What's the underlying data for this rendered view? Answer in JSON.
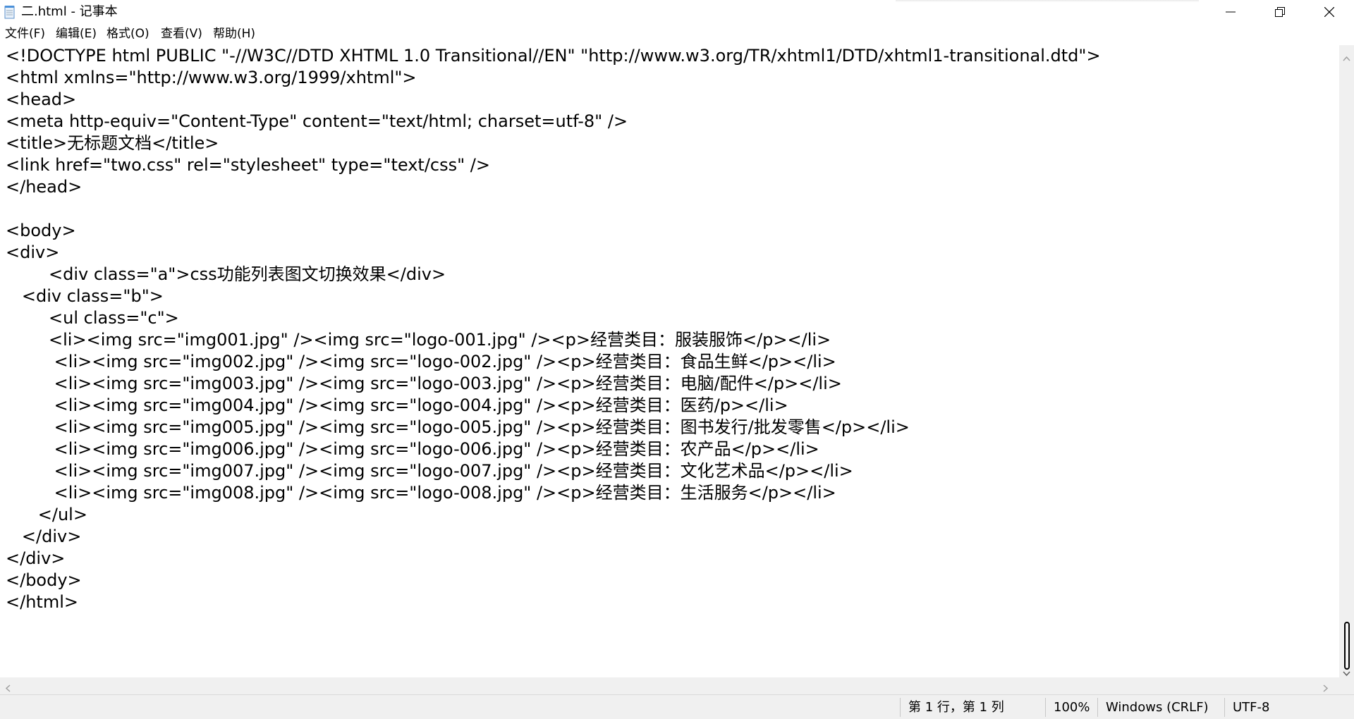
{
  "window": {
    "title": "二.html - 记事本",
    "minimize_glyph": "minimize-icon",
    "maximize_glyph": "restore-icon",
    "close_glyph": "close-icon"
  },
  "menu": {
    "items": [
      "文件(F)",
      "编辑(E)",
      "格式(O)",
      "查看(V)",
      "帮助(H)"
    ]
  },
  "editor": {
    "lines": [
      "<!DOCTYPE html PUBLIC \"-//W3C//DTD XHTML 1.0 Transitional//EN\" \"http://www.w3.org/TR/xhtml1/DTD/xhtml1-transitional.dtd\">",
      "<html xmlns=\"http://www.w3.org/1999/xhtml\">",
      "<head>",
      "<meta http-equiv=\"Content-Type\" content=\"text/html; charset=utf-8\" />",
      "<title>无标题文档</title>",
      "<link href=\"two.css\" rel=\"stylesheet\" type=\"text/css\" />",
      "</head>",
      "",
      "<body>",
      "<div>",
      "\t<div class=\"a\">css功能列表图文切换效果</div>",
      "   <div class=\"b\">",
      "\t<ul class=\"c\">",
      "\t<li><img src=\"img001.jpg\" /><img src=\"logo-001.jpg\" /><p>经营类目：服装服饰</p></li>",
      "         <li><img src=\"img002.jpg\" /><img src=\"logo-002.jpg\" /><p>经营类目：食品生鲜</p></li>",
      "         <li><img src=\"img003.jpg\" /><img src=\"logo-003.jpg\" /><p>经营类目：电脑/配件</p></li>",
      "         <li><img src=\"img004.jpg\" /><img src=\"logo-004.jpg\" /><p>经营类目：医药/p></li>",
      "         <li><img src=\"img005.jpg\" /><img src=\"logo-005.jpg\" /><p>经营类目：图书发行/批发零售</p></li>",
      "         <li><img src=\"img006.jpg\" /><img src=\"logo-006.jpg\" /><p>经营类目：农产品</p></li>",
      "         <li><img src=\"img007.jpg\" /><img src=\"logo-007.jpg\" /><p>经营类目：文化艺术品</p></li>",
      "         <li><img src=\"img008.jpg\" /><img src=\"logo-008.jpg\" /><p>经营类目：生活服务</p></li>",
      "      </ul>",
      "   </div>",
      "</div>",
      "</body>",
      "</html>"
    ]
  },
  "status": {
    "position": "第 1 行，第 1 列",
    "zoom": "100%",
    "line_ending": "Windows (CRLF)",
    "encoding": "UTF-8"
  }
}
